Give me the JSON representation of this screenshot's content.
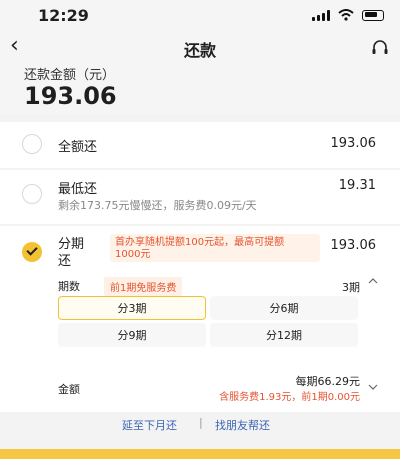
{
  "status": {
    "time": "12:29"
  },
  "nav": {
    "title": "还款"
  },
  "amount": {
    "label": "还款金额（元）",
    "value": "193.06"
  },
  "options": {
    "full": {
      "label": "全额还",
      "value": "193.06"
    },
    "min": {
      "label": "最低还",
      "value": "19.31",
      "note": "剩余173.75元慢慢还，服务费0.09元/天"
    },
    "installment": {
      "label_line1": "分期",
      "label_line2": "还",
      "value": "193.06",
      "promo_line1": "首办享随机提额100元起，最高可提额",
      "promo_line2": "1000元"
    }
  },
  "term": {
    "label": "期数",
    "badge": "前1期免服务费",
    "value": "3期"
  },
  "plans": [
    "分3期",
    "分6期",
    "分9期",
    "分12期"
  ],
  "amount_detail": {
    "label": "金额",
    "line1": "每期66.29元",
    "line2": "含服务费1.93元，前1期0.00元"
  },
  "links": {
    "defer": "延至下月还",
    "sep": "|",
    "friend": "找朋友帮还"
  },
  "colors": {
    "accent": "#f2c233",
    "promo_red": "#e5532f",
    "link_blue": "#3a64b2"
  }
}
